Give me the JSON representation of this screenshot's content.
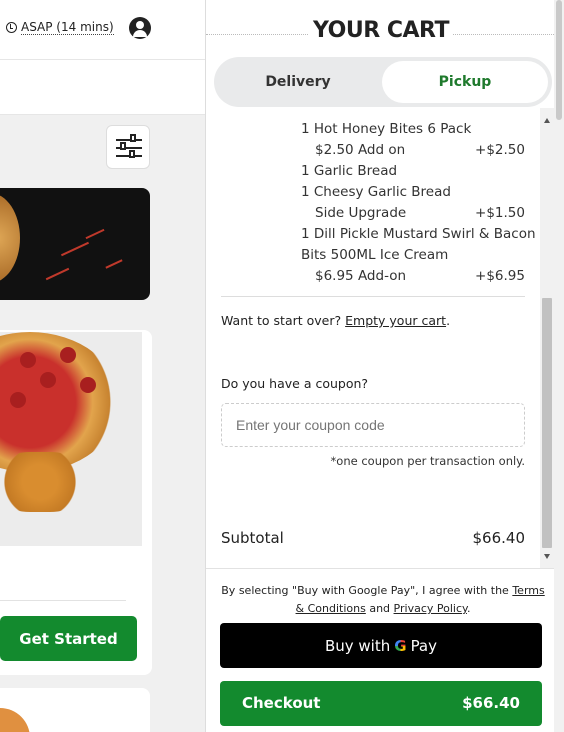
{
  "header": {
    "asap": "ASAP (14 mins)"
  },
  "promo": {
    "cta": "Get Started"
  },
  "cart": {
    "title": "YOUR CART",
    "tabs": [
      {
        "label": "Delivery",
        "selected": false
      },
      {
        "label": "Pickup",
        "selected": true
      }
    ],
    "items": [
      {
        "text": "1 Hot Honey Bites 6 Pack",
        "sub": false,
        "price": ""
      },
      {
        "text": "$2.50 Add on",
        "sub": true,
        "price": "+$2.50"
      },
      {
        "text": "1 Garlic Bread",
        "sub": false,
        "price": ""
      },
      {
        "text": "1 Cheesy Garlic Bread",
        "sub": false,
        "price": ""
      },
      {
        "text": "Side Upgrade",
        "sub": true,
        "price": "+$1.50"
      },
      {
        "text": "1 Dill Pickle Mustard Swirl & Bacon",
        "sub": false,
        "price": ""
      },
      {
        "text": "Bits 500ML Ice Cream",
        "sub": false,
        "price": ""
      },
      {
        "text": "$6.95 Add-on",
        "sub": true,
        "price": "+$6.95"
      }
    ],
    "start_over_prefix": "Want to start over?",
    "empty_cart_link": "Empty your cart",
    "coupon_label": "Do you have a coupon?",
    "coupon_placeholder": "Enter your coupon code",
    "coupon_note": "*one coupon per transaction only.",
    "subtotal_label": "Subtotal",
    "subtotal_value": "$66.40"
  },
  "footer": {
    "legal_prefix": "By selecting \"Buy with Google Pay\", I agree with the",
    "terms_link": "Terms & Conditions",
    "legal_and": "and",
    "privacy_link": "Privacy Policy",
    "gpay_prefix": "Buy with",
    "gpay_g": "G",
    "gpay_suffix": "Pay",
    "checkout_label": "Checkout",
    "checkout_amount": "$66.40"
  },
  "colors": {
    "accent_green": "#138a2e",
    "pickup_green": "#1f7a2d"
  }
}
